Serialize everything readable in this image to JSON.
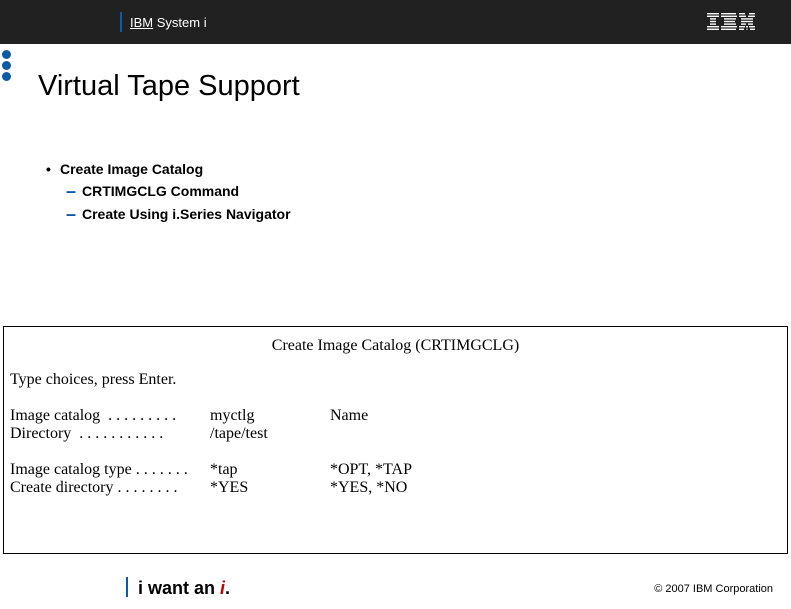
{
  "header": {
    "brand_prefix": "IBM",
    "brand_rest": " System i"
  },
  "title": "Virtual Tape Support",
  "bullets": {
    "b1": "Create Image Catalog",
    "s1": "CRTIMGCLG Command",
    "s2": "Create Using i.Series Navigator"
  },
  "panel": {
    "title": "Create Image Catalog (CRTIMGCLG)",
    "instruction": "Type choices, press Enter.",
    "row1_label": "Image catalog  . . . . . . . . .",
    "row1_val": "myctlg",
    "row1_opts": "Name",
    "row2_label": "Directory  . . . . . . . . . . .",
    "row2_val": "/tape/test",
    "row3_label": "Image catalog type . . . . . . .",
    "row3_val": "*tap",
    "row3_opts": "*OPT, *TAP",
    "row4_label": "Create directory . . . . . . . .",
    "row4_val": "*YES",
    "row4_opts": "*YES, *NO"
  },
  "footer": {
    "tag_pre": "i want an ",
    "tag_accent": "i",
    "tag_post": ".",
    "copyright": "© 2007 IBM Corporation"
  }
}
